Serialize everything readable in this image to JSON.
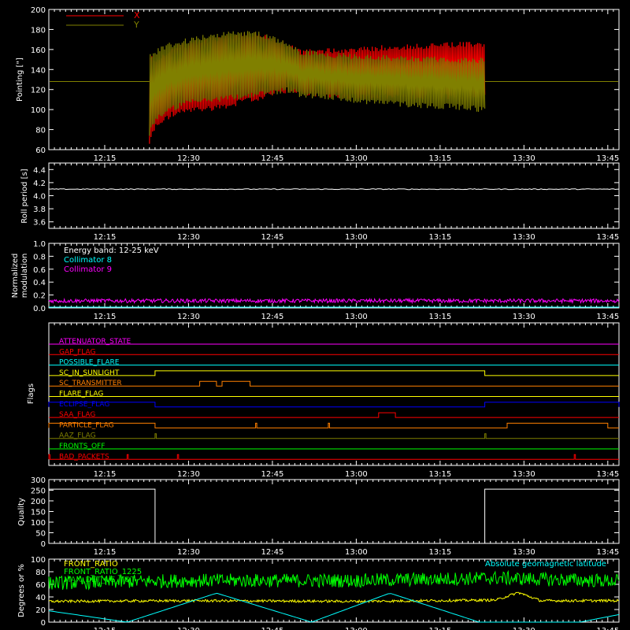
{
  "chart_data": [
    {
      "type": "line",
      "ylabel": "Pointing [\"]",
      "ylim": [
        60,
        200
      ],
      "yticks": [
        60,
        80,
        100,
        120,
        140,
        160,
        180,
        200
      ],
      "xlim": [
        "12:05",
        "13:47"
      ],
      "xtick_labels": [
        "12:15",
        "12:30",
        "12:45",
        "13:00",
        "13:15",
        "13:30",
        "13:45"
      ],
      "legend": {
        "position": "top-left",
        "entries": [
          {
            "label": "X",
            "color": "#ff0000"
          },
          {
            "label": "Y",
            "color": "#808000"
          }
        ]
      },
      "series": [
        {
          "name": "X",
          "color": "#ff0000",
          "x": [
            "12:23",
            "12:24",
            "12:27",
            "12:30",
            "12:36",
            "12:42",
            "12:48",
            "12:50",
            "12:55",
            "13:00",
            "13:10",
            "13:20",
            "13:23"
          ],
          "upper": [
            156,
            152,
            163,
            168,
            175,
            178,
            167,
            160,
            162,
            163,
            166,
            168,
            168
          ],
          "lower": [
            64,
            80,
            92,
            96,
            100,
            108,
            117,
            114,
            112,
            110,
            110,
            110,
            110
          ]
        },
        {
          "name": "Y",
          "color": "#808000",
          "x": [
            "12:23",
            "12:24",
            "12:27",
            "12:30",
            "12:36",
            "12:42",
            "12:48",
            "12:50",
            "12:55",
            "13:00",
            "13:10",
            "13:20",
            "13:23"
          ],
          "upper": [
            156,
            160,
            168,
            172,
            178,
            180,
            168,
            160,
            158,
            156,
            154,
            152,
            152
          ],
          "lower": [
            72,
            88,
            98,
            104,
            108,
            112,
            117,
            112,
            110,
            106,
            102,
            99,
            97
          ]
        }
      ],
      "reference_line": {
        "y": 128,
        "color": "#808000"
      }
    },
    {
      "type": "line",
      "ylabel": "Roll period [s]",
      "ylim": [
        3.5,
        4.5
      ],
      "yticks": [
        3.6,
        3.8,
        4.0,
        4.2,
        4.4
      ],
      "ytick_labels": [
        "3.6",
        "3.8",
        "4.0",
        "4.2",
        "4.4"
      ],
      "xtick_labels": [
        "12:15",
        "12:30",
        "12:45",
        "13:00",
        "13:15",
        "13:30",
        "13:45"
      ],
      "series": [
        {
          "color": "#ffffff",
          "value": 4.1
        }
      ]
    },
    {
      "type": "line",
      "ylabel": [
        "Normalized",
        "modulation"
      ],
      "ylim": [
        0,
        1
      ],
      "yticks": [
        0.0,
        0.2,
        0.4,
        0.6,
        0.8,
        1.0
      ],
      "ytick_labels": [
        "0.0",
        "0.2",
        "0.4",
        "0.6",
        "0.8",
        "1.0"
      ],
      "xtick_labels": [
        "12:15",
        "12:30",
        "12:45",
        "13:00",
        "13:15",
        "13:30",
        "13:45"
      ],
      "annotations": [
        {
          "text": "Energy band: 12-25 keV",
          "color": "#ffffff"
        }
      ],
      "series": [
        {
          "name": "Collimator 8",
          "color": "#00ffff",
          "value": 0.0
        },
        {
          "name": "Collimator 9",
          "color": "#ff00ff",
          "value": 0.11
        }
      ]
    },
    {
      "type": "line",
      "ylabel": "Flags",
      "xtick_labels": [
        "12:15",
        "12:30",
        "12:45",
        "13:00",
        "13:15",
        "13:30",
        "13:45"
      ],
      "flags": [
        {
          "name": "ATTENUATOR_STATE",
          "color": "#ff00ff",
          "on": []
        },
        {
          "name": "GAP_FLAG",
          "color": "#ff0000",
          "on": []
        },
        {
          "name": "POSSIBLE_FLARE",
          "color": "#00ffff",
          "on": []
        },
        {
          "name": "SC_IN_SUNLIGHT",
          "color": "#ffff00",
          "on": [
            [
              "12:24",
              "13:23"
            ]
          ]
        },
        {
          "name": "SC_TRANSMITTER",
          "color": "#ff8000",
          "on": [
            [
              "12:32",
              "12:35"
            ],
            [
              "12:36",
              "12:41"
            ]
          ]
        },
        {
          "name": "FLARE_FLAG",
          "color": "#ffff00",
          "on": []
        },
        {
          "name": "ECLIPSE_FLAG",
          "color": "#0000ff",
          "on": [
            [
              "12:05",
              "12:24"
            ],
            [
              "13:23",
              "13:47"
            ]
          ]
        },
        {
          "name": "SAA_FLAG",
          "color": "#ff0000",
          "on": [
            [
              "13:04",
              "13:07"
            ]
          ]
        },
        {
          "name": "PARTICLE_FLAG",
          "color": "#ff8000",
          "on": [
            [
              "12:05",
              "12:24"
            ],
            [
              "12:42",
              "12:42"
            ],
            [
              "12:55",
              "12:55"
            ],
            [
              "13:27",
              "13:45"
            ]
          ]
        },
        {
          "name": "AAZ_FLAG",
          "color": "#808000",
          "on": [
            [
              "12:24",
              "12:24"
            ],
            [
              "13:23",
              "13:23"
            ]
          ]
        },
        {
          "name": "FRONTS_OFF",
          "color": "#00ff00",
          "on": []
        },
        {
          "name": "BAD_PACKETS",
          "color": "#ff0000",
          "on": [
            [
              "12:05",
              "12:05"
            ],
            [
              "12:19",
              "12:19"
            ],
            [
              "12:28",
              "12:28"
            ],
            [
              "13:39",
              "13:39"
            ]
          ]
        }
      ]
    },
    {
      "type": "line",
      "ylabel": "Quality",
      "ylim": [
        0,
        300
      ],
      "yticks": [
        0,
        50,
        100,
        150,
        200,
        250,
        300
      ],
      "ytick_labels": [
        "0",
        "50",
        "100",
        "150",
        "200",
        "250",
        "300"
      ],
      "xtick_labels": [
        "12:15",
        "12:30",
        "12:45",
        "13:00",
        "13:15",
        "13:30",
        "13:45"
      ],
      "series": [
        {
          "color": "#ffffff",
          "x": [
            "12:05",
            "12:24",
            "12:24",
            "13:23",
            "13:23",
            "13:47"
          ],
          "y": [
            255,
            255,
            0,
            0,
            255,
            255
          ]
        }
      ]
    },
    {
      "type": "line",
      "ylabel": "Degrees or %",
      "ylim": [
        0,
        100
      ],
      "yticks": [
        0,
        20,
        40,
        60,
        80,
        100
      ],
      "ytick_labels": [
        "0",
        "20",
        "40",
        "60",
        "80",
        "100"
      ],
      "annotations": [
        {
          "text": "Absolute geomagnetic latitude",
          "color": "#00ffff"
        }
      ],
      "series": [
        {
          "name": "FRONT_RATIO",
          "color": "#ffff00",
          "x": [
            "12:05",
            "12:30",
            "13:00",
            "13:25",
            "13:29",
            "13:33",
            "13:47"
          ],
          "y": [
            33,
            34,
            33,
            35,
            47,
            34,
            34
          ]
        },
        {
          "name": "FRONT_RATIO_1225",
          "color": "#00ff00",
          "x": [
            "12:05",
            "12:30",
            "13:00",
            "13:25",
            "13:47"
          ],
          "y": [
            62,
            66,
            66,
            70,
            65
          ]
        },
        {
          "name": "MAX_DET_VS_TOT",
          "color": "#00c800",
          "x": [
            "12:05",
            "13:47"
          ],
          "y": [
            55,
            55
          ]
        },
        {
          "name": "Absolute geomagnetic latitude",
          "color": "#00ffff",
          "x": [
            "12:05",
            "12:19",
            "12:35",
            "12:52",
            "13:06",
            "13:22",
            "13:40",
            "13:47"
          ],
          "y": [
            18,
            0,
            46,
            0,
            46,
            0,
            0,
            12
          ]
        }
      ]
    }
  ]
}
